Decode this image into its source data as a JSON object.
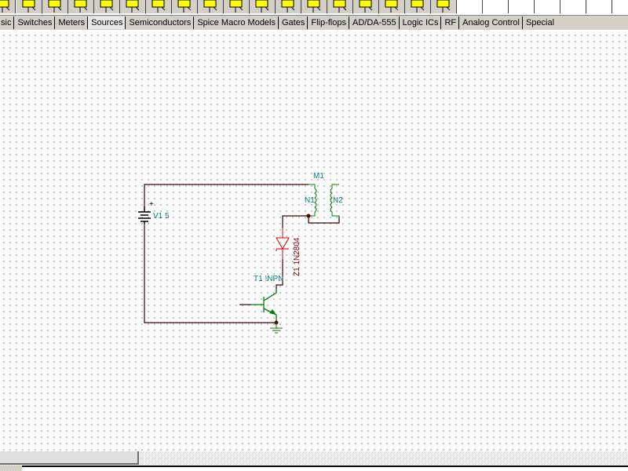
{
  "toolbar": {
    "buttons": [
      "capacitor-like",
      "ground",
      "meter-a",
      "meter-b",
      "meter-c",
      "switch-a",
      "switch-b",
      "switch-c",
      "switch-d",
      "gen-a",
      "gen-b",
      "gen-c",
      "gen-d",
      "probe",
      "gen-e",
      "gen-f",
      "ic-a",
      "ic-b"
    ]
  },
  "tabs": [
    {
      "label": "sic"
    },
    {
      "label": "Switches"
    },
    {
      "label": "Meters"
    },
    {
      "label": "Sources",
      "active": true
    },
    {
      "label": "Semiconductors"
    },
    {
      "label": "Spice Macro Models"
    },
    {
      "label": "Gates"
    },
    {
      "label": "Flip-flops"
    },
    {
      "label": "AD/DA-555"
    },
    {
      "label": "Logic ICs"
    },
    {
      "label": "RF"
    },
    {
      "label": "Analog Control"
    },
    {
      "label": "Special"
    }
  ],
  "circuit": {
    "battery": {
      "label": "V1 5",
      "plus": "+"
    },
    "transformer": {
      "label": "M1",
      "n1": "N1",
      "n2": "N2",
      "dot": "+"
    },
    "diode": {
      "label": "Z1 1N2804"
    },
    "transistor": {
      "label": "T1 !NPN"
    },
    "colors": {
      "wire": "#400000",
      "label": "#008080",
      "diode": "#e00000",
      "transistor": "#008000",
      "pin": "#c00000"
    }
  }
}
